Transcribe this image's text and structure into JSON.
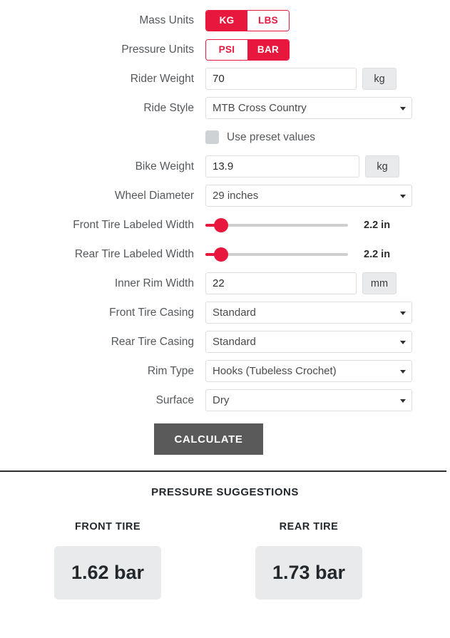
{
  "form": {
    "mass_units": {
      "label": "Mass Units",
      "options": [
        "KG",
        "LBS"
      ],
      "selected": "KG"
    },
    "pressure_units": {
      "label": "Pressure Units",
      "options": [
        "PSI",
        "BAR"
      ],
      "selected": "BAR"
    },
    "rider_weight": {
      "label": "Rider Weight",
      "value": "70",
      "unit": "kg"
    },
    "ride_style": {
      "label": "Ride Style",
      "value": "MTB Cross Country"
    },
    "use_preset": {
      "label": "Use preset values",
      "checked": false
    },
    "bike_weight": {
      "label": "Bike Weight",
      "value": "13.9",
      "unit": "kg"
    },
    "wheel_diameter": {
      "label": "Wheel Diameter",
      "value": "29 inches"
    },
    "front_tire_width": {
      "label": "Front Tire Labeled Width",
      "value": "2.2 in",
      "percent": 11
    },
    "rear_tire_width": {
      "label": "Rear Tire Labeled Width",
      "value": "2.2 in",
      "percent": 11
    },
    "inner_rim_width": {
      "label": "Inner Rim Width",
      "value": "22",
      "unit": "mm"
    },
    "front_tire_casing": {
      "label": "Front Tire Casing",
      "value": "Standard"
    },
    "rear_tire_casing": {
      "label": "Rear Tire Casing",
      "value": "Standard"
    },
    "rim_type": {
      "label": "Rim Type",
      "value": "Hooks (Tubeless Crochet)"
    },
    "surface": {
      "label": "Surface",
      "value": "Dry"
    },
    "calculate_label": "CALCULATE"
  },
  "results": {
    "title": "PRESSURE SUGGESTIONS",
    "front": {
      "title": "FRONT TIRE",
      "value": "1.62 bar"
    },
    "rear": {
      "title": "REAR TIRE",
      "value": "1.73 bar"
    }
  },
  "colors": {
    "accent": "#e8173d",
    "button": "#5a5a5a",
    "result_bg": "#e9eaec"
  }
}
